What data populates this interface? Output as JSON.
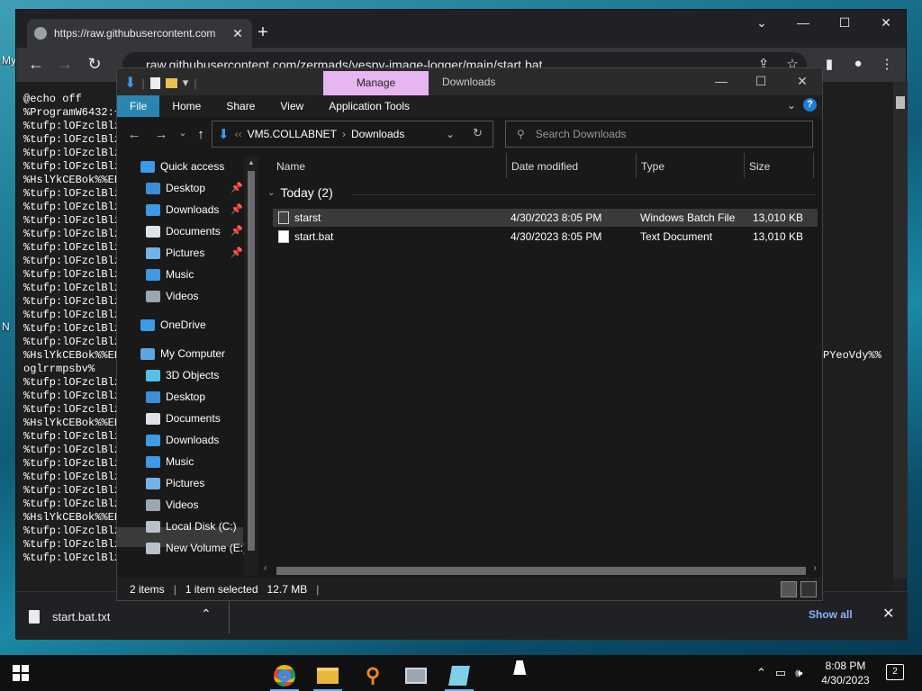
{
  "desktop": {
    "label_1": "My",
    "label_2": "N"
  },
  "chrome": {
    "tab_title": "https://raw.githubusercontent.com",
    "tab_close": "✕",
    "new_tab": "+",
    "address": "raw.githubusercontent.com/zermads/vespy-image-logger/main/start.bat",
    "code_lines": [
      "@echo off",
      "%ProgramW6432:~",
      "%tufp:lOFzclBlz",
      "%tufp:lOFzclBlz",
      "%tufp:lOFzclBlz",
      "%tufp:lOFzclBlz",
      "%HslYkCEBok%%EE",
      "%tufp:lOFzclBlz",
      "%tufp:lOFzclBlz",
      "%tufp:lOFzclBlz",
      "%tufp:lOFzclBlz",
      "%tufp:lOFzclBlz",
      "%tufp:lOFzclBlz",
      "%tufp:lOFzclBlz",
      "%tufp:lOFzclBlz",
      "%tufp:lOFzclBlz",
      "%tufp:lOFzclBlz",
      "%tufp:lOFzclBlz",
      "%tufp:lOFzclBlz",
      "%HslYkCEBok%%EE",
      "oglrrmpsbv%",
      "%tufp:lOFzclBlz",
      "%tufp:lOFzclBlz",
      "%tufp:lOFzclBlz",
      "%HslYkCEBok%%EE",
      "%tufp:lOFzclBlz",
      "%tufp:lOFzclBlz",
      "%tufp:lOFzclBlz",
      "%tufp:lOFzclBlz",
      "%tufp:lOFzclBlz",
      "%tufp:lOFzclBlz",
      "%HslYkCEBok%%EE",
      "%tufp:lOFzclBlz",
      "%tufp:lOFzclBlz",
      "%tufp:lOFzclBlz"
    ],
    "code_tail": "PYeoVdy%%",
    "download_file": "start.bat.txt",
    "show_all": "Show all"
  },
  "explorer": {
    "manage_tab": "Manage",
    "window_title": "Downloads",
    "ribbon_tabs": [
      "File",
      "Home",
      "Share",
      "View",
      "Application Tools"
    ],
    "address_parts": [
      "VM5.COLLABNET",
      "Downloads"
    ],
    "search_placeholder": "Search Downloads",
    "nav": {
      "quick_access": "Quick access",
      "qa_items": [
        "Desktop",
        "Downloads",
        "Documents",
        "Pictures",
        "Music",
        "Videos"
      ],
      "onedrive": "OneDrive",
      "my_computer": "My Computer",
      "pc_items": [
        "3D Objects",
        "Desktop",
        "Documents",
        "Downloads",
        "Music",
        "Pictures",
        "Videos",
        "Local Disk (C:)",
        "New Volume (E:)"
      ]
    },
    "columns": [
      "Name",
      "Date modified",
      "Type",
      "Size"
    ],
    "group": "Today (2)",
    "files": [
      {
        "name": "starst",
        "date": "4/30/2023 8:05 PM",
        "type": "Windows Batch File",
        "size": "13,010 KB"
      },
      {
        "name": "start.bat",
        "date": "4/30/2023 8:05 PM",
        "type": "Text Document",
        "size": "13,010 KB"
      }
    ],
    "status": {
      "count": "2 items",
      "selected": "1 item selected",
      "size": "12.7 MB"
    }
  },
  "taskbar": {
    "time": "8:08 PM",
    "date": "4/30/2023",
    "notifications": "2"
  },
  "colors": {
    "manage_tab": "#e7b5f0",
    "file_tab": "#2a85b3",
    "accent": "#1b7fd6"
  }
}
